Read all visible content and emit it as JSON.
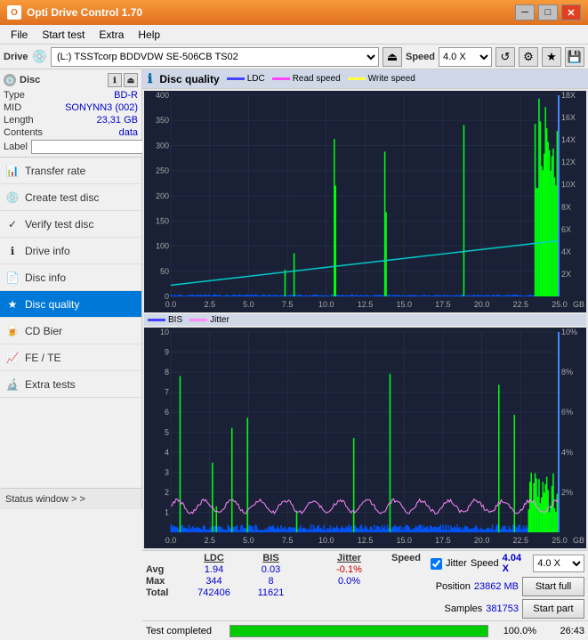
{
  "app": {
    "title": "Opti Drive Control 1.70",
    "titlebar_buttons": [
      "minimize",
      "maximize",
      "close"
    ]
  },
  "menubar": {
    "items": [
      "File",
      "Start test",
      "Extra",
      "Help"
    ]
  },
  "drive_bar": {
    "drive_label": "Drive",
    "drive_value": "(L:)  TSSTcorp BDDVDW SE-506CB TS02",
    "speed_label": "Speed",
    "speed_value": "4.0 X"
  },
  "disc": {
    "header": "Disc",
    "type_label": "Type",
    "type_value": "BD-R",
    "mid_label": "MID",
    "mid_value": "SONYNN3 (002)",
    "length_label": "Length",
    "length_value": "23,31 GB",
    "contents_label": "Contents",
    "contents_value": "data",
    "label_label": "Label",
    "label_value": ""
  },
  "nav": {
    "items": [
      {
        "id": "transfer-rate",
        "label": "Transfer rate",
        "icon": "📊"
      },
      {
        "id": "create-test-disc",
        "label": "Create test disc",
        "icon": "💿"
      },
      {
        "id": "verify-test-disc",
        "label": "Verify test disc",
        "icon": "✓"
      },
      {
        "id": "drive-info",
        "label": "Drive info",
        "icon": "ℹ"
      },
      {
        "id": "disc-info",
        "label": "Disc info",
        "icon": "📄"
      },
      {
        "id": "disc-quality",
        "label": "Disc quality",
        "icon": "★",
        "active": true
      },
      {
        "id": "cd-bier",
        "label": "CD Bier",
        "icon": "🍺"
      },
      {
        "id": "fe-te",
        "label": "FE / TE",
        "icon": "📈"
      },
      {
        "id": "extra-tests",
        "label": "Extra tests",
        "icon": "🔬"
      }
    ]
  },
  "status_window": {
    "label": "Status window > >"
  },
  "chart": {
    "title": "Disc quality",
    "legend": [
      {
        "label": "LDC",
        "color": "#0000ff"
      },
      {
        "label": "Read speed",
        "color": "#ff00ff"
      },
      {
        "label": "Write speed",
        "color": "#ffff00"
      }
    ],
    "legend2": [
      {
        "label": "BIS",
        "color": "#0000ff"
      },
      {
        "label": "Jitter",
        "color": "#ff00ff"
      }
    ],
    "top_y_max": 400,
    "top_y_right_max": 18,
    "bottom_y_max": 10,
    "bottom_y_right_max": 10,
    "x_max": 25
  },
  "stats": {
    "columns": [
      "",
      "LDC",
      "BIS",
      "",
      "Jitter",
      "Speed",
      ""
    ],
    "avg_label": "Avg",
    "avg_ldc": "1.94",
    "avg_bis": "0.03",
    "avg_jitter": "-0.1%",
    "max_label": "Max",
    "max_ldc": "344",
    "max_bis": "8",
    "max_jitter": "0.0%",
    "total_label": "Total",
    "total_ldc": "742406",
    "total_bis": "11621"
  },
  "controls": {
    "jitter_checked": true,
    "jitter_label": "Jitter",
    "speed_label": "Speed",
    "speed_value": "4.04 X",
    "speed_select": "4.0 X",
    "position_label": "Position",
    "position_value": "23862 MB",
    "samples_label": "Samples",
    "samples_value": "381753",
    "btn_start_full": "Start full",
    "btn_start_part": "Start part"
  },
  "progress": {
    "status_text": "Test completed",
    "percent": 100,
    "percent_text": "100.0%",
    "time_text": "26:43"
  },
  "colors": {
    "accent_orange": "#e07020",
    "active_blue": "#0078d7",
    "chart_bg": "#1a2035",
    "grid_color": "#2a3a55",
    "ldc_color": "#0000ff",
    "bis_color": "#0000ff",
    "speed_line": "#00ffff",
    "jitter_color": "#ff88ff",
    "spike_green": "#00ff00",
    "spike_yellow": "#ffff00"
  }
}
